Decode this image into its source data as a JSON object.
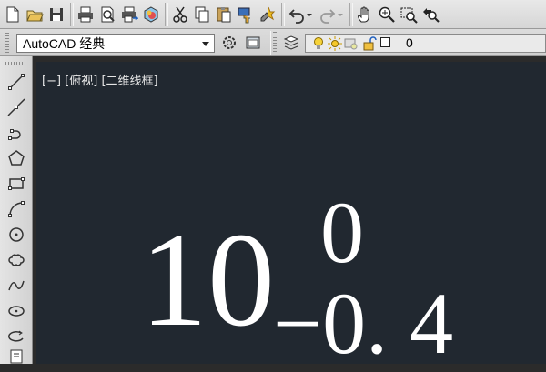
{
  "toolbar": {
    "standard_icons": [
      "new-file-icon",
      "open-folder-icon",
      "save-icon",
      "print-icon",
      "print-preview-icon",
      "publish-icon",
      "plot-3d-icon",
      "cut-icon",
      "copy-icon",
      "paste-icon",
      "match-properties-icon",
      "block-editor-icon",
      "undo-icon",
      "undo-dropdown-icon",
      "redo-icon",
      "redo-dropdown-icon",
      "pan-hand-icon",
      "zoom-realtime-icon",
      "zoom-window-icon",
      "zoom-previous-icon"
    ]
  },
  "workspace": {
    "selected": "AutoCAD 经典"
  },
  "layer": {
    "current_name": "0"
  },
  "draw_tools": [
    "line-icon",
    "construction-line-icon",
    "polyline-icon",
    "polygon-icon",
    "rectangle-icon",
    "arc-icon",
    "circle-icon",
    "revision-cloud-icon",
    "spline-icon",
    "ellipse-icon",
    "ellipse-arc-icon",
    "insert-block-icon"
  ],
  "canvas": {
    "viewport_label": "[−] [俯视] [二维线框]",
    "main_text": "10",
    "upper_tolerance": "0",
    "lower_tolerance": "−0. 4"
  },
  "colors": {
    "canvas_background": "#212830",
    "toolbar_background": "#dcdcdc",
    "text": "#ffffff"
  }
}
